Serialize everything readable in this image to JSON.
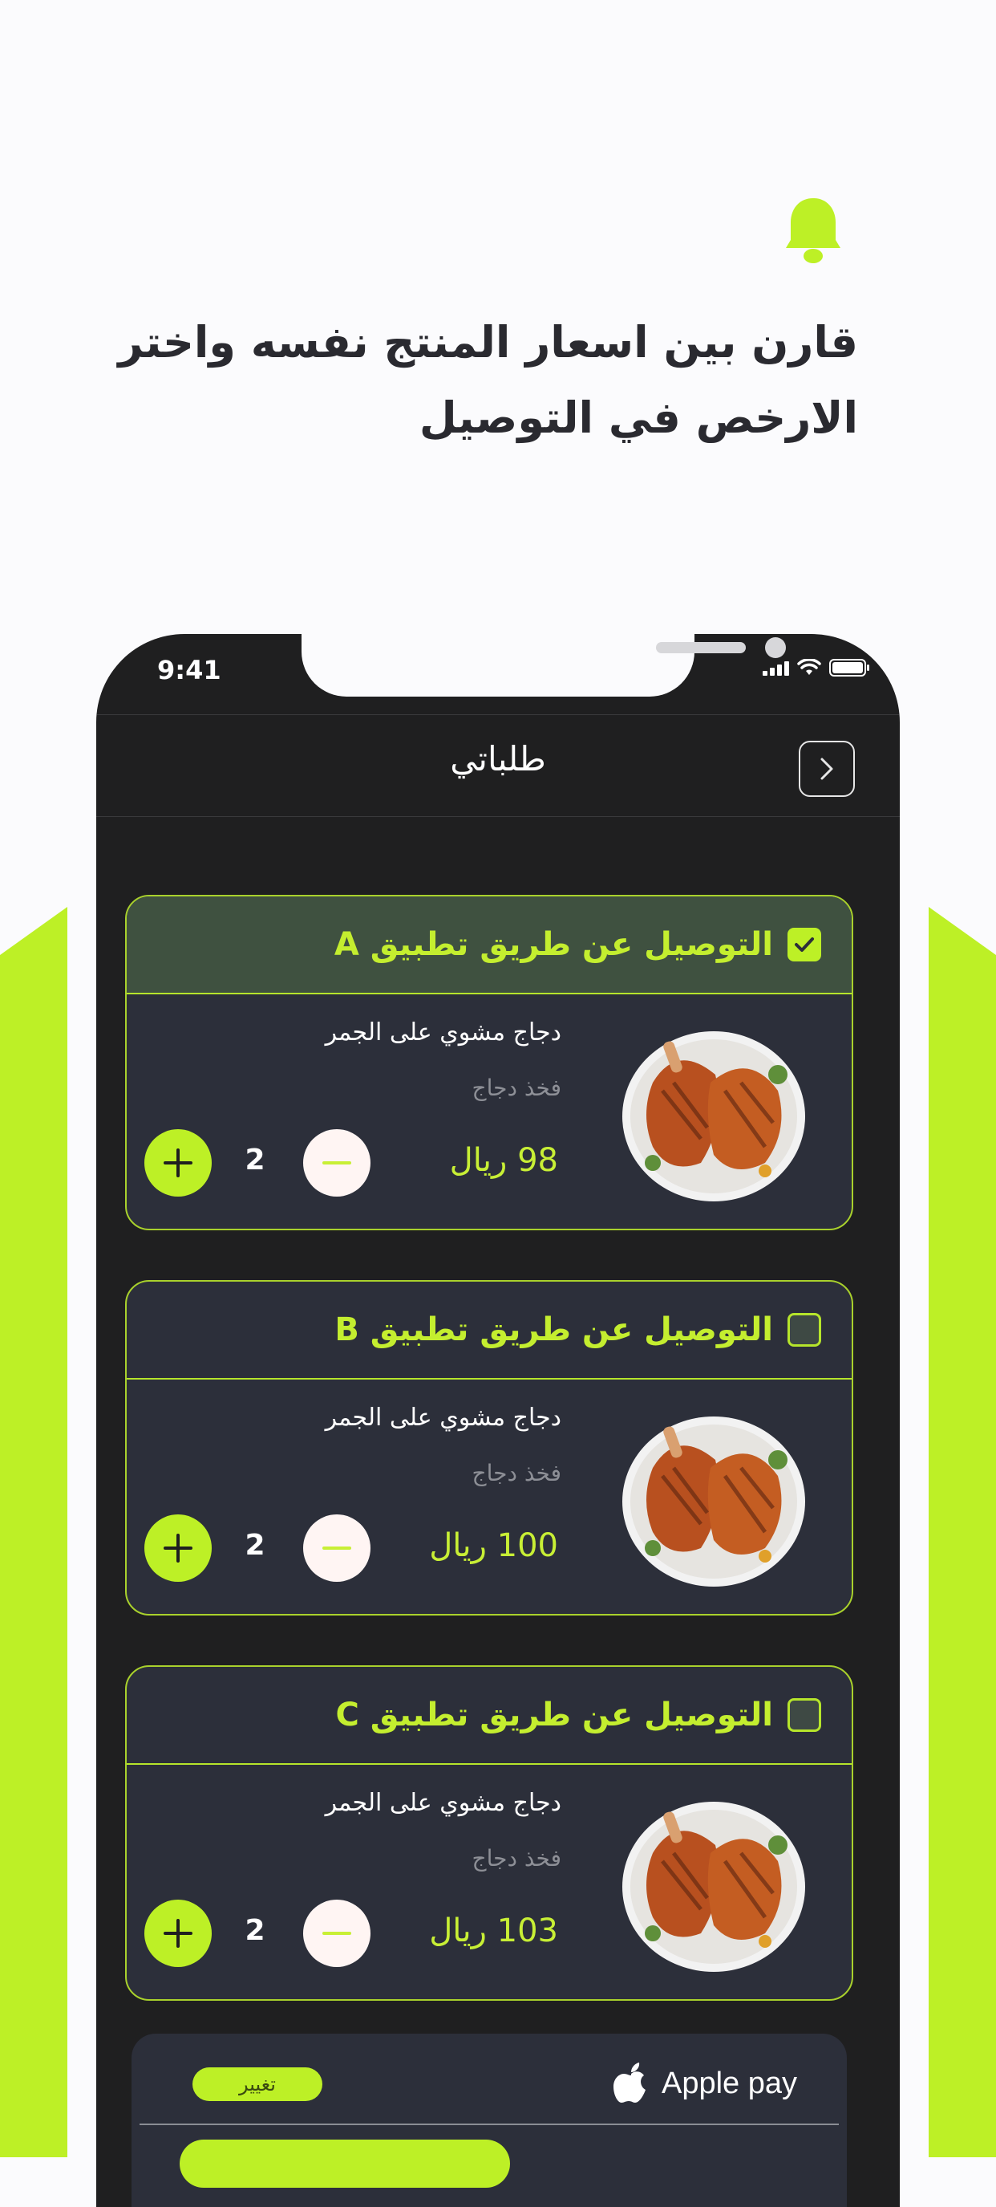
{
  "headline": {
    "line1": "قارن بين اسعار المنتج نفسه واختر",
    "line2": "الارخص في التوصيل"
  },
  "status_bar": {
    "time": "9:41"
  },
  "app_bar": {
    "title": "طلباتي"
  },
  "orders": [
    {
      "title": "التوصيل عن طريق تطبيق A",
      "checked": true,
      "item_name": "دجاج مشوي على الجمر",
      "item_sub": "فخذ دجاج",
      "price": "98 ريال",
      "quantity": "2"
    },
    {
      "title": "التوصيل عن طريق تطبيق B",
      "checked": false,
      "item_name": "دجاج مشوي على الجمر",
      "item_sub": "فخذ دجاج",
      "price": "100 ريال",
      "quantity": "2"
    },
    {
      "title": "التوصيل عن طريق تطبيق C",
      "checked": false,
      "item_name": "دجاج مشوي على الجمر",
      "item_sub": "فخذ دجاج",
      "price": "103 ريال",
      "quantity": "2"
    }
  ],
  "payment": {
    "method": "Apple pay",
    "change_label": "تغيير"
  },
  "colors": {
    "accent": "#bdf026",
    "phone_bg": "#1f1f20",
    "card_bg": "#2c2f3a"
  }
}
